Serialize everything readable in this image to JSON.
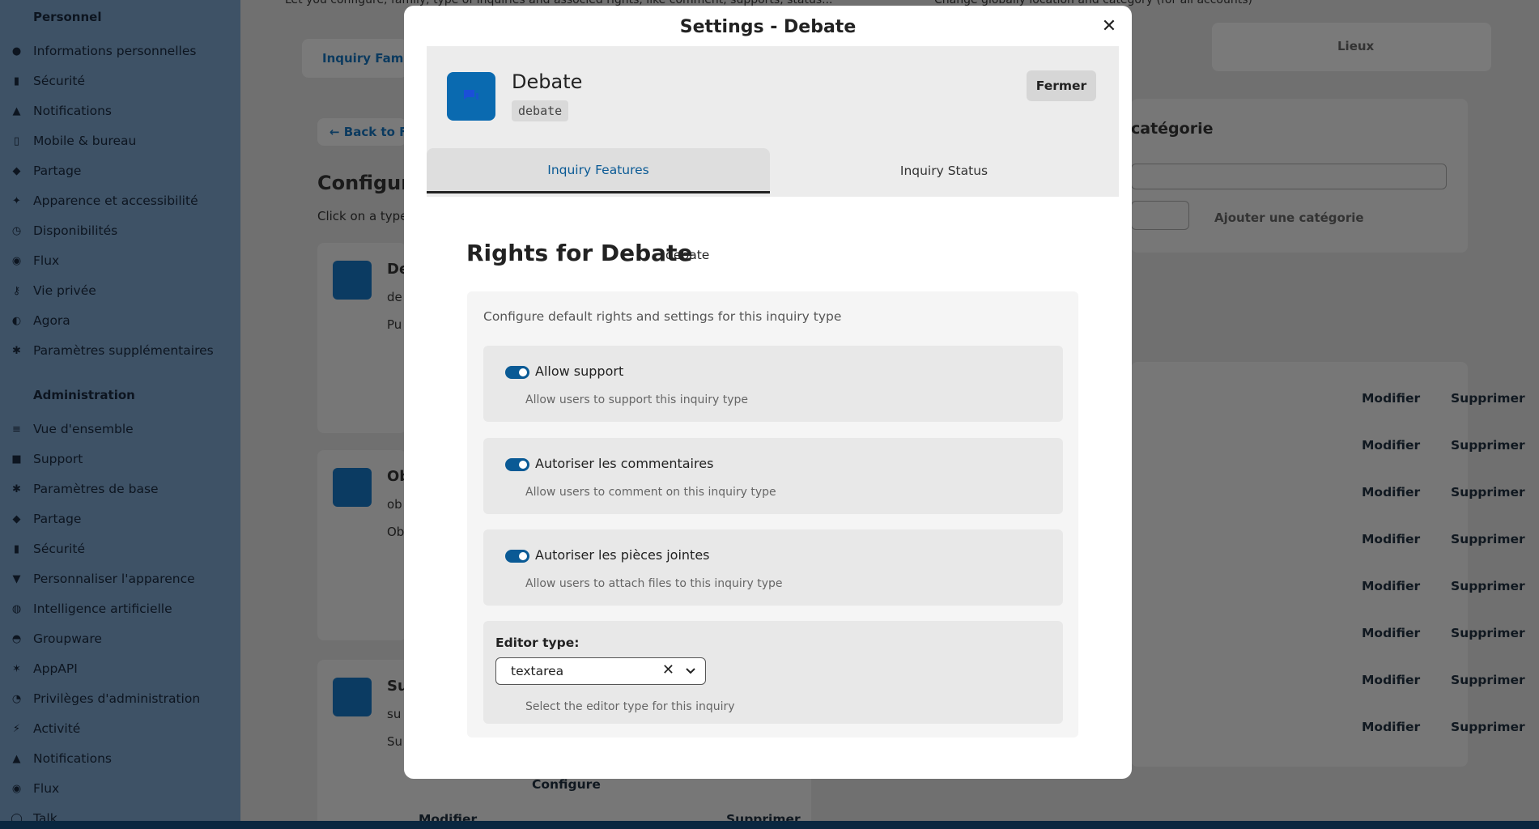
{
  "sidebar": {
    "section_personal": "Personnel",
    "personal_items": [
      {
        "icon": "person-icon",
        "label": "Informations personnelles"
      },
      {
        "icon": "lock-icon",
        "label": "Sécurité"
      },
      {
        "icon": "bell-icon",
        "label": "Notifications"
      },
      {
        "icon": "phone-icon",
        "label": "Mobile & bureau"
      },
      {
        "icon": "share-icon",
        "label": "Partage"
      },
      {
        "icon": "accessibility-icon",
        "label": "Apparence et accessibilité"
      },
      {
        "icon": "clock-icon",
        "label": "Disponibilités"
      },
      {
        "icon": "stream-icon",
        "label": "Flux"
      },
      {
        "icon": "key-icon",
        "label": "Vie privée"
      },
      {
        "icon": "agora-icon",
        "label": "Agora"
      },
      {
        "icon": "gear-icon",
        "label": "Paramètres supplémentaires"
      }
    ],
    "section_admin": "Administration",
    "admin_items": [
      {
        "icon": "sliders-icon",
        "label": "Vue d'ensemble"
      },
      {
        "icon": "chat-icon",
        "label": "Support"
      },
      {
        "icon": "gear-icon",
        "label": "Paramètres de base"
      },
      {
        "icon": "share-icon",
        "label": "Partage"
      },
      {
        "icon": "lock-icon",
        "label": "Sécurité"
      },
      {
        "icon": "brush-icon",
        "label": "Personnaliser l'apparence"
      },
      {
        "icon": "ai-icon",
        "label": "Intelligence artificielle"
      },
      {
        "icon": "group-icon",
        "label": "Groupware"
      },
      {
        "icon": "app-icon",
        "label": "AppAPI"
      },
      {
        "icon": "admin-icon",
        "label": "Privilèges d'administration"
      },
      {
        "icon": "lightning-icon",
        "label": "Activité"
      },
      {
        "icon": "bell-icon",
        "label": "Notifications"
      },
      {
        "icon": "stream-icon",
        "label": "Flux"
      },
      {
        "icon": "talk-icon",
        "label": "Talk"
      }
    ]
  },
  "background": {
    "top_left_text": "Let you configure, family, type of inquiries and associed rights, like comment, supports, status...",
    "top_right_text": "Change globally location and category (for all accounts)",
    "tab_family": "Inquiry Famil",
    "back_link": "← Back to Fa",
    "configure_heading": "Configure",
    "click_text": "Click on a type",
    "tab_places": "Lieux",
    "category_heading": "catégorie",
    "add_category": "Ajouter une catégorie",
    "cards": [
      {
        "title": "De",
        "key": "de",
        "desc": "Pu"
      },
      {
        "title": "Ob",
        "key": "ob",
        "desc": "Ob"
      },
      {
        "title": "Su",
        "key": "su",
        "desc": "Su"
      }
    ],
    "configure_btn": "Configure",
    "modify": "Modifier",
    "delete": "Supprimer",
    "list_rows": 8
  },
  "modal": {
    "title": "Settings - Debate",
    "type_name": "Debate",
    "type_key": "debate",
    "close_button": "Fermer",
    "tabs": [
      {
        "label": "Inquiry Features",
        "active": true
      },
      {
        "label": "Inquiry Status",
        "active": false
      }
    ],
    "rights_title": "Rights for Debate",
    "rights_key": "debate",
    "settings_description": "Configure default rights and settings for this inquiry type",
    "features": [
      {
        "label": "Allow support",
        "help": "Allow users to support this inquiry type",
        "enabled": true
      },
      {
        "label": "Autoriser les commentaires",
        "help": "Allow users to comment on this inquiry type",
        "enabled": true
      },
      {
        "label": "Autoriser les pièces jointes",
        "help": "Allow users to attach files to this inquiry type",
        "enabled": true
      }
    ],
    "editor": {
      "label": "Editor type:",
      "value": "textarea",
      "help": "Select the editor type for this inquiry"
    }
  },
  "colors": {
    "accent": "#0a5a95",
    "type_icon_bg": "#0a6ab0"
  }
}
